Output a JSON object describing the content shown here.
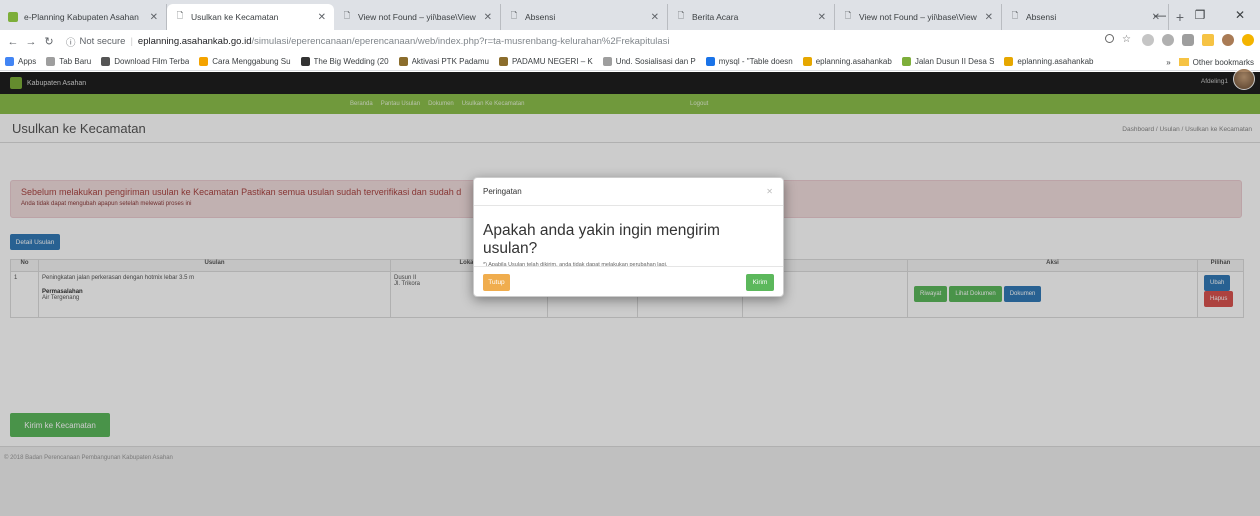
{
  "browser": {
    "tabs": [
      {
        "title": "e-Planning Kabupaten Asahan",
        "icon": "green-favicon"
      },
      {
        "title": "Usulkan ke Kecamatan",
        "icon": "page-icon",
        "active": true
      },
      {
        "title": "View not Found – yii\\base\\View",
        "icon": "page-icon"
      },
      {
        "title": "Absensi",
        "icon": "page-icon"
      },
      {
        "title": "Berita Acara",
        "icon": "page-icon"
      },
      {
        "title": "View not Found – yii\\base\\View",
        "icon": "page-icon"
      },
      {
        "title": "Absensi",
        "icon": "page-icon"
      }
    ],
    "security_label": "Not secure",
    "url_host": "eplanning.asahankab.go.id",
    "url_path": "/simulasi/eperencanaan/eperencanaan/web/index.php?r=ta-musrenbang-kelurahan%2Frekapitulasi",
    "bookmarks": [
      {
        "label": "Apps",
        "color": "#4285f4"
      },
      {
        "label": "Tab Baru",
        "color": "#9e9e9e"
      },
      {
        "label": "Download Film Terba",
        "color": "#555555"
      },
      {
        "label": "Cara Menggabung Su",
        "color": "#f4a300"
      },
      {
        "label": "The Big Wedding (20",
        "color": "#333333"
      },
      {
        "label": "Aktivasi PTK Padamu",
        "color": "#8b6d2c"
      },
      {
        "label": "PADAMU NEGERI – K",
        "color": "#8b6d2c"
      },
      {
        "label": "Und. Sosialisasi dan P",
        "color": "#9e9e9e"
      },
      {
        "label": "mysql - \"Table doesn",
        "color": "#1a73e8"
      },
      {
        "label": "eplanning.asahankab",
        "color": "#e6a700"
      },
      {
        "label": "Jalan Dusun II Desa S",
        "color": "#7dae3a"
      },
      {
        "label": "eplanning.asahankab",
        "color": "#e6a700"
      }
    ],
    "other_bookmarks": "Other bookmarks"
  },
  "app": {
    "brand": "Kabupaten Asahan",
    "user": "Afdeling1",
    "menu": [
      "Beranda",
      "Pantau Usulan",
      "Dokumen",
      "Usulkan Ke Kecamatan"
    ],
    "logout": "Logout",
    "page_title": "Usulkan ke Kecamatan",
    "breadcrumb": "Dashboard  /  Usulan  /  Usulkan ke Kecamatan",
    "alert_main": "Sebelum melakukan pengiriman usulan ke Kecamatan Pastikan semua usulan sudah terverifikasi dan sudah d",
    "alert_sub": "Anda tidak dapat mengubah apapun setelah melewati proses ini",
    "detail_button": "Detail Usulan",
    "table": {
      "headers": [
        "No",
        "Usulan",
        "Lokasi",
        "",
        "",
        "",
        "Aksi",
        "Pilihan"
      ],
      "row": {
        "no": "1",
        "usulan": "Peningkatan jalan perkerasan dengan hotmix lebar 3.5 m",
        "permasalahan_label": "Permasalahan",
        "permasalahan": "Air Tergenang",
        "lokasi1": "Dusun II",
        "lokasi2": "Jl. Trikora",
        "aksi": [
          "Riwayat",
          "Lihat Dokumen",
          "Dokumen"
        ],
        "pilihan": [
          "Ubah",
          "Hapus"
        ]
      }
    },
    "submit_button": "Kirim ke Kecamatan",
    "footer": "© 2018 Badan Perencanaan Pembangunan Kabupaten Asahan"
  },
  "modal": {
    "title": "Peringatan",
    "question": "Apakah anda yakin ingin mengirim usulan?",
    "note": "*) Apabila Usulan telah dikirim, anda tidak dapat melakukan perubahan lagi.",
    "cancel": "Tutup",
    "confirm": "Kirim"
  },
  "colors": {
    "green": "#5cb85c",
    "blue": "#337ab7",
    "red": "#d9534f",
    "orange": "#f0ad4e",
    "menubar": "#8dc04c"
  }
}
